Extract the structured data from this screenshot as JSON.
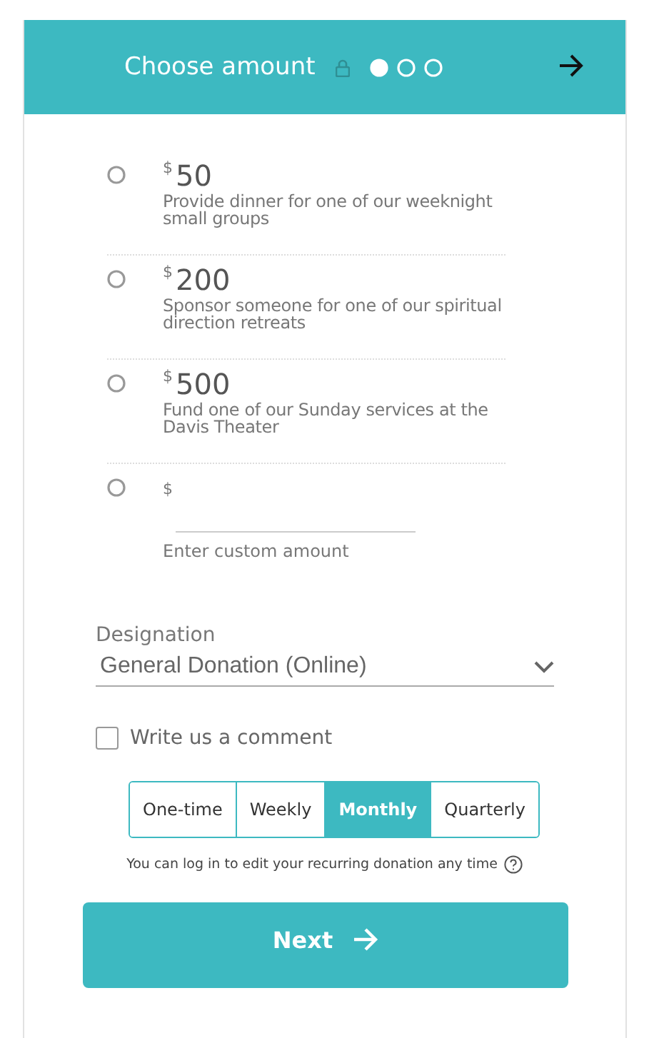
{
  "header": {
    "title": "Choose amount",
    "steps": [
      {
        "selected": true
      },
      {
        "selected": false
      },
      {
        "selected": false
      }
    ]
  },
  "amounts": [
    {
      "currency": "$",
      "amount": "50",
      "description": "Provide dinner for one of our weeknight small groups",
      "selected": false
    },
    {
      "currency": "$",
      "amount": "200",
      "description": "Sponsor someone for one of our spiritual direction retreats",
      "selected": false
    },
    {
      "currency": "$",
      "amount": "500",
      "description": "Fund one of our Sunday services at the Davis Theater",
      "selected": false
    }
  ],
  "custom_amount": {
    "currency": "$",
    "hint": "Enter custom amount",
    "selected": false
  },
  "designation": {
    "label": "Designation",
    "value": "General Donation (Online)"
  },
  "comment": {
    "label": "Write us a comment",
    "checked": false
  },
  "frequency": [
    {
      "label": "One-time",
      "selected": false
    },
    {
      "label": "Weekly",
      "selected": false
    },
    {
      "label": "Monthly",
      "selected": true
    },
    {
      "label": "Quarterly",
      "selected": false
    }
  ],
  "note": "You can log in to edit your recurring donation any time",
  "next_button": "Next"
}
